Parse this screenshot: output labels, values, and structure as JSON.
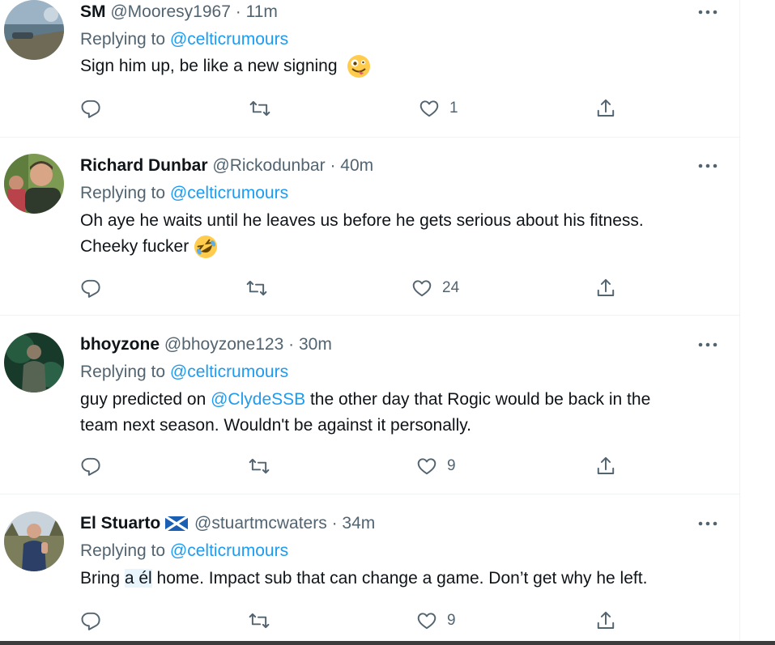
{
  "tweets": [
    {
      "name": "SM",
      "handle": "@Mooresy1967",
      "dot": "·",
      "time": "11m",
      "replying_prefix": "Replying to",
      "replying_to": "@celticrumours",
      "text": "Sign him up, be like a new signing",
      "emoji_icon": "zany-face-emoji",
      "likes": "1",
      "avatar_colors": {
        "sky": "#9bb3c4",
        "water": "#5f7888",
        "ground": "#6e6a55"
      }
    },
    {
      "name": "Richard Dunbar",
      "handle": "@Rickodunbar",
      "dot": "·",
      "time": "40m",
      "replying_prefix": "Replying to",
      "replying_to": "@celticrumours",
      "text_line1": "Oh aye he waits until he leaves us before he gets serious about his fitness.",
      "text_line2": "Cheeky fucker",
      "emoji_icon": "rolling-on-floor-laughing-emoji",
      "likes": "24",
      "avatar_colors": {
        "bg": "#7d9a52",
        "face": "#d8a587",
        "shirt": "#2f3a2c"
      }
    },
    {
      "name": "bhoyzone",
      "handle": "@bhoyzone123",
      "dot": "·",
      "time": "30m",
      "replying_prefix": "Replying to",
      "replying_to": "@celticrumours",
      "text_prefix": "guy predicted on ",
      "mention": "@ClydeSSB",
      "text_line1_rest": " the other day that Rogic would be back in the",
      "text_line2": "team next season. Wouldn't be against it personally.",
      "likes": "9",
      "avatar_colors": {
        "bg": "#173a2b",
        "glow": "#3f8a64",
        "figure": "#586453"
      }
    },
    {
      "name": "El Stuarto",
      "flag_icon": "scotland-flag-icon",
      "handle": "@stuartmcwaters",
      "dot": "·",
      "time": "34m",
      "replying_prefix": "Replying to",
      "replying_to": "@celticrumours",
      "text_before": "Bring ",
      "text_highlight": "a él",
      "text_after": " home. Impact sub that can change a game. Don’t get why he left.",
      "likes": "9",
      "avatar_colors": {
        "bg": "#c9d3dc",
        "trees": "#7c7d5a",
        "jacket": "#2c3f66"
      }
    }
  ],
  "icons": {
    "reply": "reply-icon",
    "retweet": "retweet-icon",
    "like": "like-icon",
    "share": "share-icon",
    "more": "more-icon"
  },
  "colors": {
    "link": "#1d9bf0",
    "secondary_text": "#536471",
    "divider": "#eff3f4",
    "highlight": "#e8f5fd"
  }
}
